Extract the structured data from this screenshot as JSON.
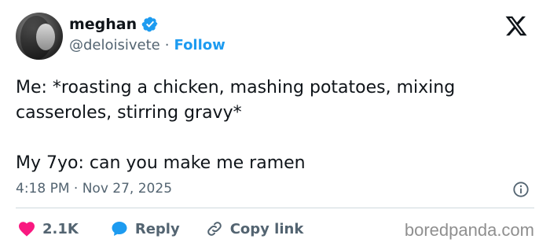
{
  "user": {
    "name": "meghan",
    "handle": "@deloisivete",
    "separator": "·",
    "follow_label": "Follow"
  },
  "tweet": {
    "text": "Me: *roasting a chicken, mashing potatoes, mixing\ncasseroles, stirring gravy*\n\nMy 7yo: can you make me ramen",
    "time": "4:18 PM",
    "date_separator": "·",
    "date": "Nov 27, 2025"
  },
  "actions": {
    "like_count": "2.1K",
    "reply_label": "Reply",
    "copy_link_label": "Copy link"
  },
  "watermark": "boredpanda.com",
  "icons": {
    "verified": "verified-badge-icon",
    "logo": "x-logo-icon",
    "info": "info-icon",
    "like": "heart-icon",
    "reply": "speech-bubble-icon",
    "copy": "link-icon"
  },
  "colors": {
    "accent": "#1d9bf0",
    "like": "#f91880",
    "text": "#0f1419",
    "muted": "#536471"
  }
}
